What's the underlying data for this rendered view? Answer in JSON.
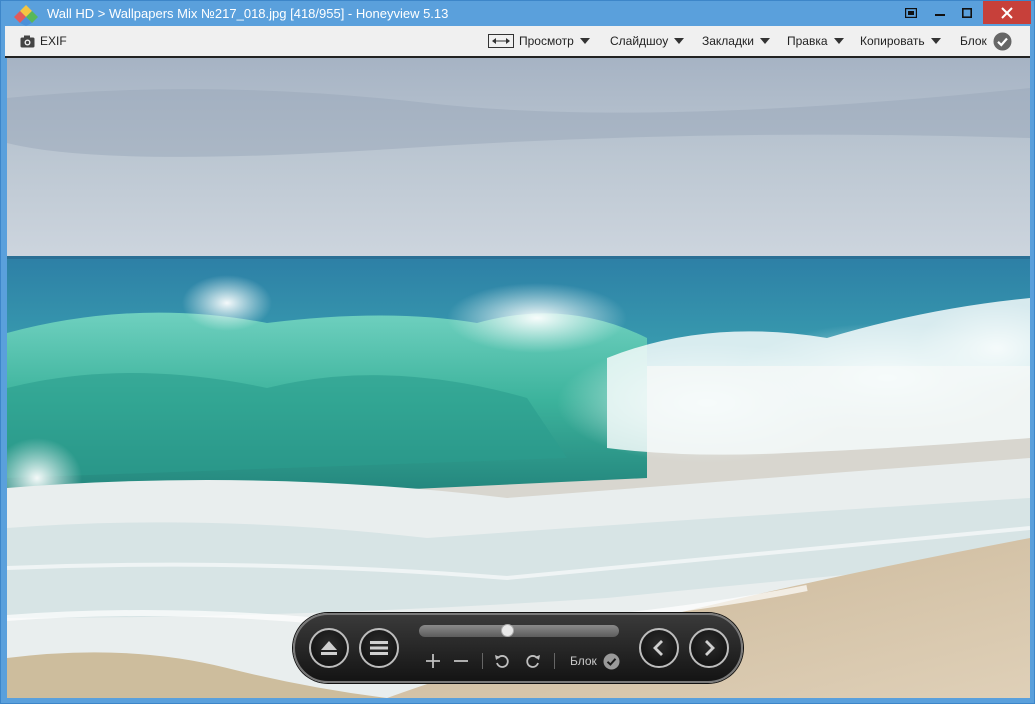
{
  "window": {
    "title": "Wall HD > Wallpapers Mix №217_018.jpg [418/955] - Honeyview 5.13",
    "accent": "#5aa0dc",
    "close_color": "#c7403a"
  },
  "toolbar": {
    "exif_label": "EXIF",
    "view_label": "Просмотр",
    "slideshow_label": "Слайдшоу",
    "bookmarks_label": "Закладки",
    "edit_label": "Правка",
    "copy_label": "Копировать",
    "lock_label": "Блок"
  },
  "controls": {
    "lock_label": "Блок",
    "position_fraction": 0.437
  },
  "icons": [
    "app-icon",
    "fullscreen-icon",
    "minimize-icon",
    "maximize-icon",
    "close-icon",
    "camera-icon",
    "view-mode-icon",
    "check-icon",
    "eject-icon",
    "menu-icon",
    "zoom-in-icon",
    "zoom-out-icon",
    "rotate-left-icon",
    "rotate-right-icon",
    "chevron-left-icon",
    "chevron-right-icon"
  ]
}
